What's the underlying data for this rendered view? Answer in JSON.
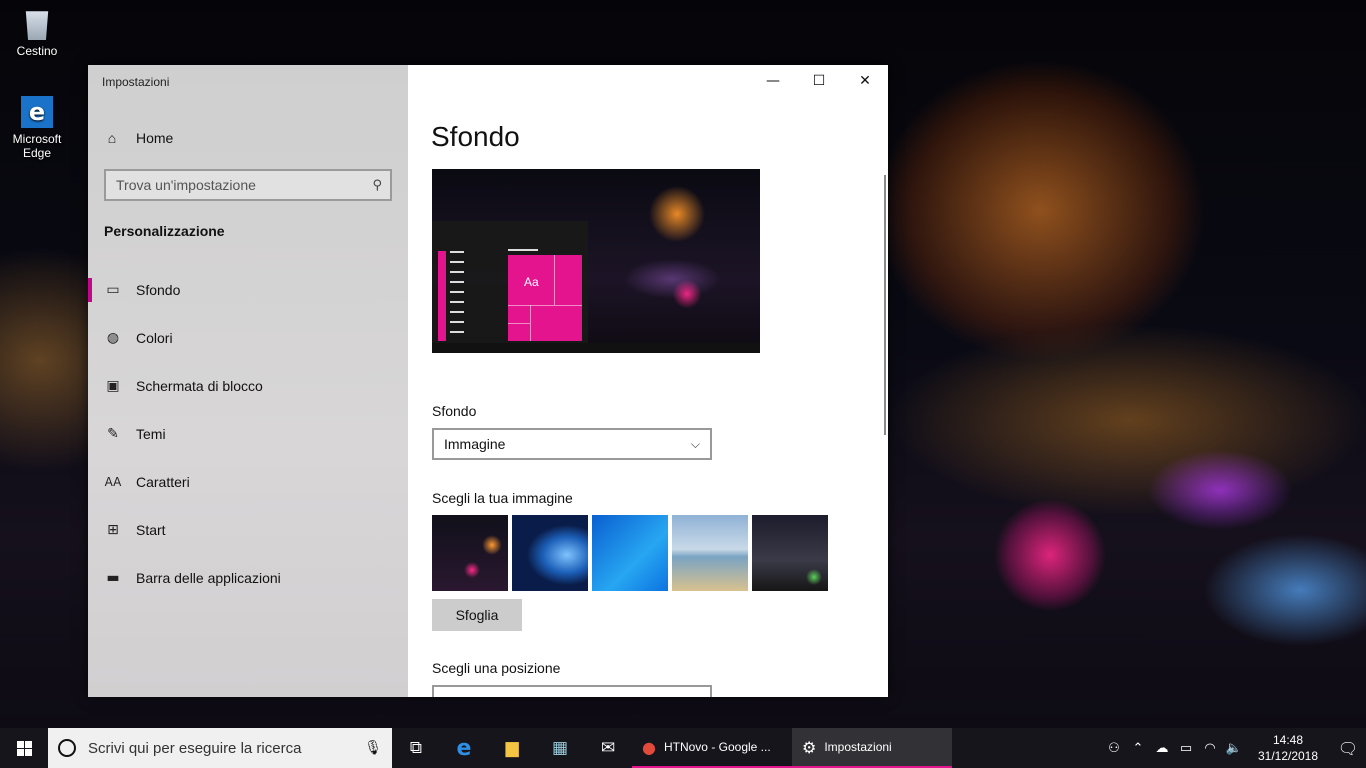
{
  "desktop": {
    "icons": [
      {
        "label": "Cestino",
        "icon": "recycle-bin-icon"
      },
      {
        "label": "Microsoft Edge",
        "icon": "edge-icon"
      }
    ]
  },
  "window": {
    "app_title": "Impostazioni",
    "controls": {
      "minimize": "—",
      "maximize": "☐",
      "close": "✕"
    },
    "sidebar": {
      "home_label": "Home",
      "search_placeholder": "Trova un'impostazione",
      "section_title": "Personalizzazione",
      "items": [
        {
          "label": "Sfondo",
          "icon": "picture-icon",
          "active": true
        },
        {
          "label": "Colori",
          "icon": "palette-icon"
        },
        {
          "label": "Schermata di blocco",
          "icon": "lock-screen-icon"
        },
        {
          "label": "Temi",
          "icon": "themes-icon"
        },
        {
          "label": "Caratteri",
          "icon": "fonts-icon"
        },
        {
          "label": "Start",
          "icon": "start-icon"
        },
        {
          "label": "Barra delle applicazioni",
          "icon": "taskbar-icon"
        }
      ]
    },
    "content": {
      "page_title": "Sfondo",
      "preview_tile_label": "Aa",
      "background_label": "Sfondo",
      "background_value": "Immagine",
      "choose_image_label": "Scegli la tua immagine",
      "browse_label": "Sfoglia",
      "choose_position_label": "Scegli una posizione"
    }
  },
  "taskbar": {
    "search_placeholder": "Scrivi qui per eseguire la ricerca",
    "apps": [
      {
        "label": "HTNovo - Google ...",
        "icon": "chrome-icon"
      },
      {
        "label": "Impostazioni",
        "icon": "gear-icon"
      }
    ],
    "clock_time": "14:48",
    "clock_date": "31/12/2018"
  },
  "accent_color": "#e3148e"
}
